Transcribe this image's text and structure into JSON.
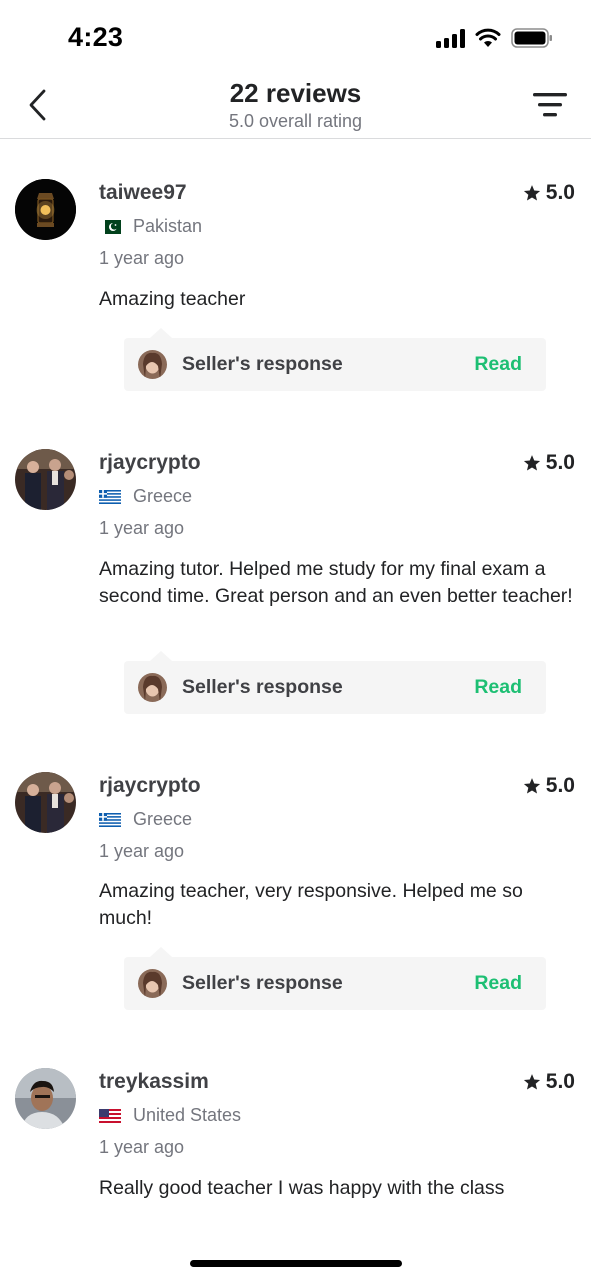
{
  "status_bar": {
    "time": "4:23"
  },
  "header": {
    "title": "22 reviews",
    "subtitle": "5.0 overall rating"
  },
  "reviews": [
    {
      "username": "taiwee97",
      "rating": "5.0",
      "country": "Pakistan",
      "time_ago": "1 year ago",
      "text": "Amazing teacher",
      "response_label": "Seller's response",
      "read_label": "Read"
    },
    {
      "username": "rjaycrypto",
      "rating": "5.0",
      "country": "Greece",
      "time_ago": "1 year ago",
      "text": "Amazing tutor. Helped me study for my final exam a second time. Great person and an even better teacher!",
      "response_label": "Seller's response",
      "read_label": "Read"
    },
    {
      "username": "rjaycrypto",
      "rating": "5.0",
      "country": "Greece",
      "time_ago": "1 year ago",
      "text": "Amazing teacher, very responsive. Helped me so much!",
      "response_label": "Seller's response",
      "read_label": "Read"
    },
    {
      "username": "treykassim",
      "rating": "5.0",
      "country": "United States",
      "time_ago": "1 year ago",
      "text": "Really good teacher I was happy with the class"
    }
  ],
  "colors": {
    "accent_green": "#1dbf73",
    "muted_text": "#74767e",
    "response_bg": "#f5f5f5"
  },
  "icons": [
    "chevron-left-icon",
    "filter-icon",
    "star-icon",
    "signal-icon",
    "wifi-icon",
    "battery-icon"
  ]
}
